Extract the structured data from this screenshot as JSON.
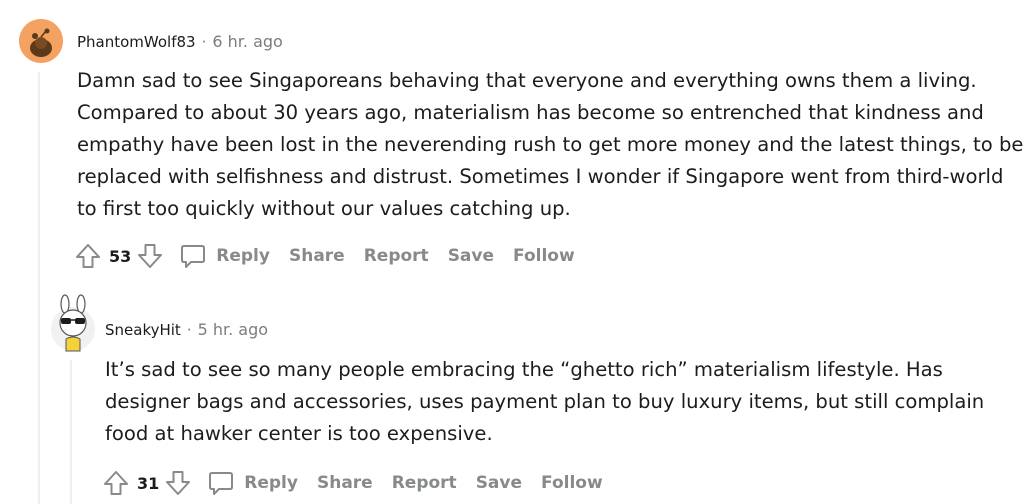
{
  "comments": [
    {
      "username": "PhantomWolf83",
      "separator": "·",
      "time": "6 hr. ago",
      "body": [
        "Damn sad to see Singaporeans behaving that everyone and everything owns them a living.",
        "Compared to about 30 years ago, materialism has become so entrenched that kindness and",
        "empathy have been lost in the neverending rush to get more money and the latest things, to be",
        "replaced with selfishness and distrust. Sometimes I wonder if Singapore went from third-world",
        "to first too quickly without our values catching up."
      ],
      "score": "53",
      "avatar_icon": "snoo-avatar-icon",
      "avatar_color": "#f4a261"
    },
    {
      "username": "SneakyHit",
      "separator": "·",
      "time": "5 hr. ago",
      "body": [
        "It’s sad to see so many people embracing the “ghetto rich” materialism lifestyle. Has",
        "designer bags and accessories, uses payment plan to buy luxury items, but still complain",
        "food at hawker center is too expensive."
      ],
      "score": "31",
      "avatar_icon": "bunny-sunglasses-avatar-icon",
      "avatar_color": "#f5f5f5"
    }
  ],
  "actions": {
    "reply": "Reply",
    "share": "Share",
    "report": "Report",
    "save": "Save",
    "follow": "Follow"
  },
  "icons": [
    "upvote-icon",
    "downvote-icon",
    "comment-icon"
  ],
  "colors": {
    "text": "#1c1c1c",
    "muted": "#7c7c7c",
    "action": "#878a8c",
    "thread_line": "#edeff1"
  }
}
